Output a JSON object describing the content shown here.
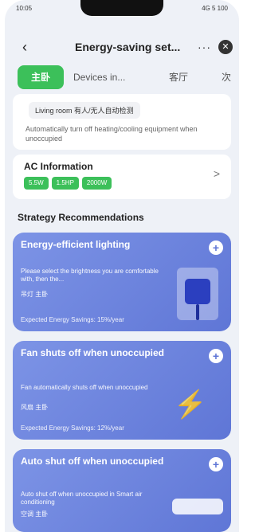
{
  "status": {
    "time": "10:05",
    "indicators": "4G 5 100"
  },
  "header": {
    "back_icon": "back-icon",
    "title": "Energy-saving set...",
    "more": "···",
    "close_icon": "close-icon"
  },
  "tabs": [
    {
      "label": "主卧",
      "active": true
    },
    {
      "label": "Devices in...",
      "active": false
    },
    {
      "label": "客厅",
      "active": false
    },
    {
      "label": "次",
      "active": false
    }
  ],
  "automation": {
    "chip": "Living room 有人/无人自动检测",
    "description": "Automatically turn off heating/cooling equipment when unoccupied"
  },
  "ac_info": {
    "title": "AC Information",
    "tags": [
      "5.5W",
      "1.5HP",
      "2000W"
    ],
    "chevron": ">"
  },
  "section_title": "Strategy Recommendations",
  "recommendations": [
    {
      "title": "Energy-efficient lighting",
      "description": "Please select the brightness you are comfortable with, then the...",
      "tags": "吊灯 主卧",
      "footer": "Expected Energy Savings: 15%/year",
      "icon": "lamp-icon",
      "color": "#5f76d6"
    },
    {
      "title": "Fan shuts off when unoccupied",
      "description": "Fan automatically shuts off when unoccupied",
      "tags": "风扇 主卧",
      "footer": "Expected Energy Savings: 12%/year",
      "icon": "lightning-icon",
      "color": "#5f76d6"
    },
    {
      "title": "Auto shut off when unoccupied",
      "description": "Auto shut off when unoccupied in Smart air conditioning",
      "tags": "空调 主卧",
      "footer": "",
      "icon": "ac-unit-icon",
      "color": "#5f76d6"
    }
  ]
}
